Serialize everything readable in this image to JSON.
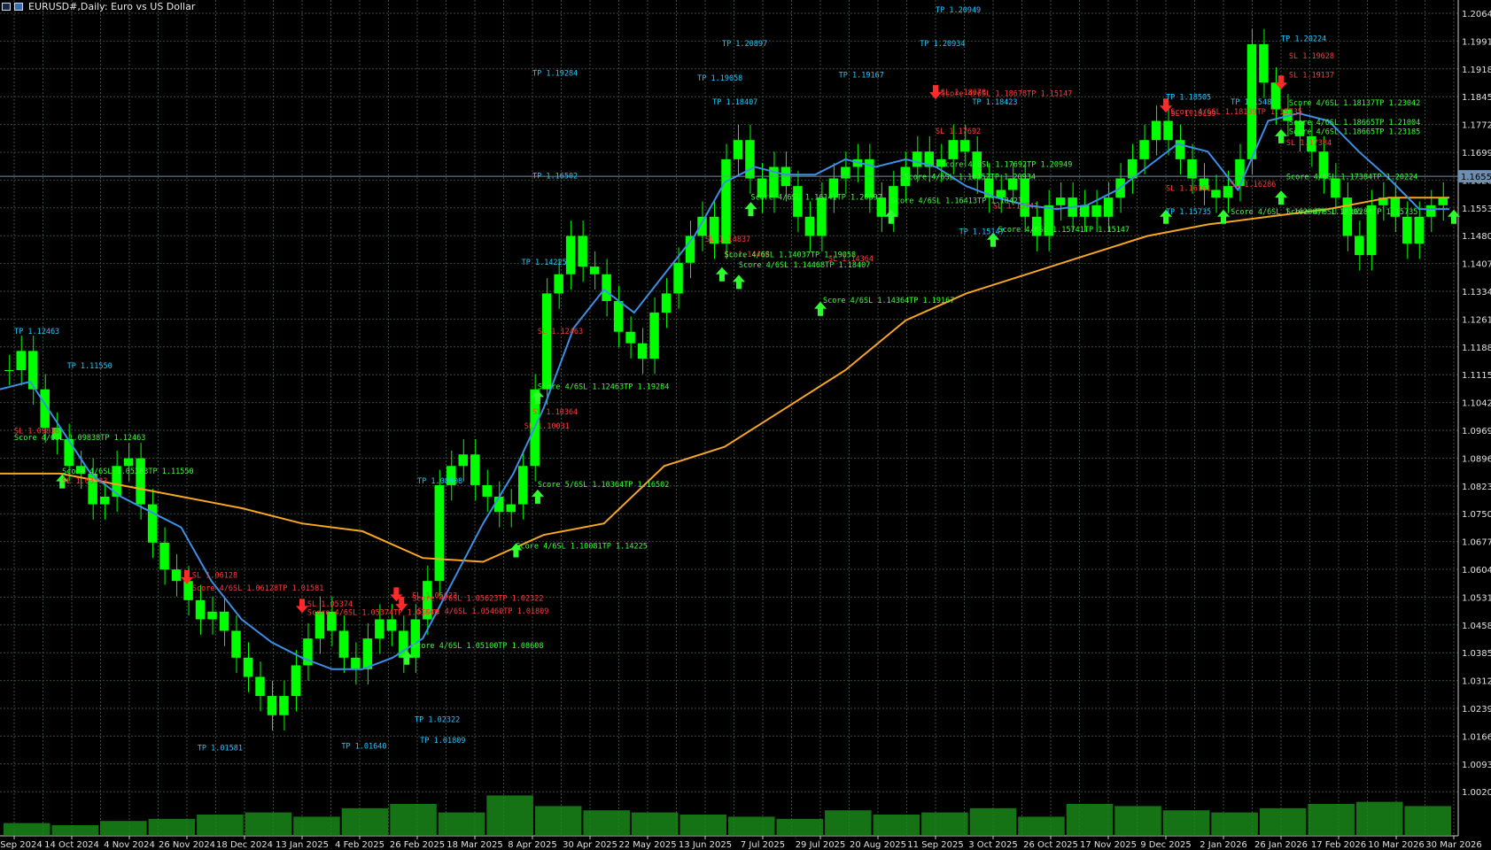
{
  "window": {
    "title": "EURUSD#,Daily: Euro vs US Dollar"
  },
  "colors": {
    "background": "#000000",
    "grid": "#3a4a3a",
    "bull_candle": "#00ff00",
    "ma_fast": "#3b8fe6",
    "ma_slow": "#f5a623",
    "buy_signal": "#2dff2d",
    "sell_signal": "#ff2b2b",
    "tp_label": "#20c8ff",
    "sl_label": "#ff3b3b",
    "buy_text": "#39ff39",
    "price_line": "#6f8fb0"
  },
  "price_axis": {
    "labels": [
      "1.20648",
      "1.19910",
      "1.19180",
      "1.18450",
      "1.17720",
      "1.16990",
      "1.16260",
      "1.15530",
      "1.14800",
      "1.14070",
      "1.13340",
      "1.12610",
      "1.11880",
      "1.11150",
      "1.10420",
      "1.09690",
      "1.08960",
      "1.08230",
      "1.07500",
      "1.06770",
      "1.06040",
      "1.05310",
      "1.04580",
      "1.03850",
      "1.03120",
      "1.02390",
      "1.01660",
      "1.00930",
      "1.00200"
    ],
    "current_price": "1.16555"
  },
  "time_axis": {
    "labels": [
      "20 Sep 2024",
      "14 Oct 2024",
      "4 Nov 2024",
      "26 Nov 2024",
      "18 Dec 2024",
      "13 Jan 2025",
      "4 Feb 2025",
      "26 Feb 2025",
      "18 Mar 2025",
      "8 Apr 2025",
      "30 Apr 2025",
      "22 May 2025",
      "13 Jun 2025",
      "7 Jul 2025",
      "29 Jul 2025",
      "20 Aug 2025",
      "11 Sep 2025",
      "3 Oct 2025",
      "26 Oct 2025",
      "17 Nov 2025",
      "9 Dec 2025",
      "2 Jan 2026",
      "26 Jan 2026",
      "17 Feb 2026",
      "10 Mar 2026",
      "30 Mar 2026"
    ]
  },
  "chart_data": {
    "type": "candlestick",
    "symbol": "EURUSD#",
    "timeframe": "Daily",
    "ylim": [
      1.0,
      1.2083
    ],
    "grid": true,
    "ma_fast": [
      1.11,
      1.112,
      1.1,
      1.088,
      1.082,
      1.078,
      1.074,
      1.06,
      1.05,
      1.044,
      1.04,
      1.037,
      1.037,
      1.04,
      1.045,
      1.06,
      1.075,
      1.088,
      1.105,
      1.126,
      1.136,
      1.13,
      1.14,
      1.15,
      1.164,
      1.168,
      1.166,
      1.166,
      1.17,
      1.168,
      1.17,
      1.168,
      1.163,
      1.16,
      1.158,
      1.157,
      1.158,
      1.162,
      1.168,
      1.174,
      1.172,
      1.162,
      1.18,
      1.182,
      1.18,
      1.172,
      1.165,
      1.157,
      1.157
    ],
    "ma_slow": [
      1.088,
      1.088,
      1.085,
      1.082,
      1.079,
      1.075,
      1.073,
      1.066,
      1.065,
      1.072,
      1.075,
      1.09,
      1.095,
      1.105,
      1.115,
      1.128,
      1.135,
      1.14,
      1.145,
      1.15,
      1.153,
      1.155,
      1.157,
      1.16,
      1.16
    ],
    "candles": [
      1.115,
      1.12,
      1.11,
      1.1,
      1.097,
      1.09,
      1.088,
      1.08,
      1.082,
      1.09,
      1.092,
      1.08,
      1.07,
      1.063,
      1.06,
      1.055,
      1.05,
      1.052,
      1.047,
      1.04,
      1.035,
      1.03,
      1.025,
      1.03,
      1.038,
      1.045,
      1.052,
      1.047,
      1.04,
      1.037,
      1.045,
      1.05,
      1.047,
      1.04,
      1.05,
      1.06,
      1.085,
      1.09,
      1.093,
      1.085,
      1.082,
      1.078,
      1.08,
      1.09,
      1.11,
      1.135,
      1.14,
      1.15,
      1.142,
      1.14,
      1.133,
      1.125,
      1.122,
      1.118,
      1.13,
      1.135,
      1.143,
      1.15,
      1.155,
      1.148,
      1.17,
      1.175,
      1.165,
      1.16,
      1.168,
      1.163,
      1.155,
      1.15,
      1.16,
      1.165,
      1.168,
      1.17,
      1.16,
      1.155,
      1.163,
      1.168,
      1.172,
      1.168,
      1.17,
      1.175,
      1.172,
      1.165,
      1.16,
      1.162,
      1.165,
      1.155,
      1.15,
      1.158,
      1.16,
      1.155,
      1.158,
      1.155,
      1.16,
      1.165,
      1.17,
      1.175,
      1.18,
      1.175,
      1.17,
      1.165,
      1.162,
      1.16,
      1.163,
      1.17,
      1.2,
      1.19,
      1.183,
      1.18,
      1.176,
      1.172,
      1.165,
      1.16,
      1.15,
      1.145,
      1.158,
      1.16,
      1.155,
      1.148,
      1.155,
      1.158,
      1.16
    ],
    "volume": [
      0.12,
      0.1,
      0.14,
      0.16,
      0.2,
      0.22,
      0.18,
      0.26,
      0.3,
      0.22,
      0.38,
      0.28,
      0.24,
      0.22,
      0.2,
      0.18,
      0.16,
      0.24,
      0.2,
      0.22,
      0.26,
      0.18,
      0.3,
      0.28,
      0.24,
      0.22,
      0.26,
      0.3,
      0.32,
      0.28
    ],
    "sell_markers": [
      {
        "date": "26 Nov 2024",
        "price": 1.061
      },
      {
        "date": "13 Jan 2025",
        "price": 1.0535
      },
      {
        "date": "18 Feb 2025",
        "price": 1.0565
      },
      {
        "date": "20 Feb 2025",
        "price": 1.054
      },
      {
        "date": "11 Sep 2025",
        "price": 1.1875
      },
      {
        "date": "9 Dec 2025",
        "price": 1.184
      },
      {
        "date": "26 Jan 2026",
        "price": 1.19
      }
    ],
    "buy_markers": [
      {
        "date": "10 Oct 2024",
        "price": 1.086
      },
      {
        "date": "22 Feb 2025",
        "price": 1.04
      },
      {
        "date": "2 Apr 2025",
        "price": 1.068
      },
      {
        "date": "10 Apr 2025",
        "price": 1.082
      },
      {
        "date": "10 Apr 2025",
        "price": 1.108
      },
      {
        "date": "20 Jun 2025",
        "price": 1.14
      },
      {
        "date": "27 Jun 2025",
        "price": 1.138
      },
      {
        "date": "2 Jul 2025",
        "price": 1.157
      },
      {
        "date": "29 Jul 2025",
        "price": 1.131
      },
      {
        "date": "25 Aug 2025",
        "price": 1.155
      },
      {
        "date": "3 Oct 2025",
        "price": 1.149
      },
      {
        "date": "9 Dec 2025",
        "price": 1.155
      },
      {
        "date": "2 Jan 2026",
        "price": 1.155
      },
      {
        "date": "26 Jan 2026",
        "price": 1.16
      },
      {
        "date": "26 Jan 2026",
        "price": 1.176
      },
      {
        "date": "30 Mar 2026",
        "price": 1.155
      }
    ]
  },
  "annotations": {
    "tp": [
      {
        "text": "TP 1.20949",
        "date": "11 Sep 2025",
        "price": 1.2083
      },
      {
        "text": "TP 1.20897",
        "date": "20 Jun 2025",
        "price": 1.1995
      },
      {
        "text": "TP 1.20934",
        "date": "5 Sep 2025",
        "price": 1.1995
      },
      {
        "text": "TP 1.19284",
        "date": "8 Apr 2025",
        "price": 1.1918
      },
      {
        "text": "TP 1.19058",
        "date": "10 Jun 2025",
        "price": 1.1905
      },
      {
        "text": "TP 1.19167",
        "date": "5 Aug 2025",
        "price": 1.1913
      },
      {
        "text": "TP 1.18407",
        "date": "16 Jun 2025",
        "price": 1.1843
      },
      {
        "text": "TP 1.18423",
        "date": "25 Sep 2025",
        "price": 1.1843
      },
      {
        "text": "TP 1.18505",
        "date": "9 Dec 2025",
        "price": 1.1855
      },
      {
        "text": "TP 1.1548",
        "date": "5 Jan 2026",
        "price": 1.1843
      },
      {
        "text": "TP 1.20224",
        "date": "26 Jan 2026",
        "price": 1.2008
      },
      {
        "text": "TP 1.16502",
        "date": "8 Apr 2025",
        "price": 1.165
      },
      {
        "text": "TP 1.15147",
        "date": "20 Sep 2025",
        "price": 1.1505
      },
      {
        "text": "TP 1.14225",
        "date": "4 Apr 2025",
        "price": 1.1425
      },
      {
        "text": "TP 1.12463",
        "date": "20 Sep 2024",
        "price": 1.1245
      },
      {
        "text": "TP 1.11550",
        "date": "12 Oct 2024",
        "price": 1.1155
      },
      {
        "text": "TP 1.08608",
        "date": "26 Feb 2025",
        "price": 1.0855
      },
      {
        "text": "TP 1.02322",
        "date": "25 Feb 2025",
        "price": 1.0232
      },
      {
        "text": "TP 1.01809",
        "date": "27 Feb 2025",
        "price": 1.0178
      },
      {
        "text": "TP 1.01640",
        "date": "28 Jan 2025",
        "price": 1.0163
      },
      {
        "text": "TP 1.01581",
        "date": "30 Nov 2024",
        "price": 1.0158
      },
      {
        "text": "TP 1.15735",
        "date": "9 Dec 2025",
        "price": 1.1557
      }
    ],
    "sl": [
      {
        "text": "SL 1.06128",
        "date": "28 Nov 2024",
        "price": 1.0608
      },
      {
        "text": "SL 1.05374",
        "date": "15 Jan 2025",
        "price": 1.0533
      },
      {
        "text": "SL 1.05623",
        "date": "24 Feb 2025",
        "price": 1.0555
      },
      {
        "text": "SL 1.03533",
        "date": "10 Oct 2024",
        "price": 1.0855
      },
      {
        "text": "SL 1.09836",
        "date": "20 Sep 2024",
        "price": 1.0985
      },
      {
        "text": "SL 1.12463",
        "date": "10 Apr 2025",
        "price": 1.1245
      },
      {
        "text": "SL 1.10364",
        "date": "8 Apr 2025",
        "price": 1.1035
      },
      {
        "text": "SL 1.10031",
        "date": "5 Apr 2025",
        "price": 1.0998
      },
      {
        "text": "SL 1.14837",
        "date": "13 Jun 2025",
        "price": 1.1485
      },
      {
        "text": "SL 1.14468",
        "date": "21 Jun 2025",
        "price": 1.1446
      },
      {
        "text": "SL 1.14364",
        "date": "1 Aug 2025",
        "price": 1.1434
      },
      {
        "text": "SL 1.17692",
        "date": "11 Sep 2025",
        "price": 1.1767
      },
      {
        "text": "SL 1.16161",
        "date": "9 Dec 2025",
        "price": 1.1618
      },
      {
        "text": "SL 1.15741",
        "date": "3 Oct 2025",
        "price": 1.1572
      },
      {
        "text": "SL 1.17384",
        "date": "28 Jan 2026",
        "price": 1.1737
      },
      {
        "text": "SL 1.16286",
        "date": "5 Jan 2026",
        "price": 1.1628
      },
      {
        "text": "SL 1.19628",
        "date": "29 Jan 2026",
        "price": 1.1963
      },
      {
        "text": "SL 1.19137",
        "date": "29 Jan 2026",
        "price": 1.1913
      },
      {
        "text": "SL 1.18139",
        "date": "11 Dec 2025",
        "price": 1.1813
      },
      {
        "text": "SL 1.18678",
        "date": "13 Sep 2025",
        "price": 1.1868
      }
    ],
    "score_buy": [
      {
        "text": "Score 4/6SL 1.09838TP 1.12463",
        "date": "20 Sep 2024",
        "price": 1.0968
      },
      {
        "text": "Score 4/6SL 1.05383TP 1.11550",
        "date": "10 Oct 2024",
        "price": 1.088
      },
      {
        "text": "Score 4/6SL 1.05100TP 1.08608",
        "date": "24 Feb 2025",
        "price": 1.0425
      },
      {
        "text": "Score 4/6SL 1.10081TP 1.14225",
        "date": "2 Apr 2025",
        "price": 1.0685
      },
      {
        "text": "Score 5/6SL 1.10364TP 1.16502",
        "date": "10 Apr 2025",
        "price": 1.0845
      },
      {
        "text": "Score 4/6SL 1.12463TP 1.19284",
        "date": "10 Apr 2025",
        "price": 1.11
      },
      {
        "text": "Score 4/6SL 1.14037TP 1.19058",
        "date": "21 Jun 2025",
        "price": 1.1445
      },
      {
        "text": "Score 4/6SL 1.14468TP 1.18407",
        "date": "27 Jun 2025",
        "price": 1.1418
      },
      {
        "text": "Score 4/6SL 1.14364TP 1.19167",
        "date": "30 Jul 2025",
        "price": 1.1325
      },
      {
        "text": "Score 4/6SL 1.16141TP 1.20897",
        "date": "2 Jul 2025",
        "price": 1.1595
      },
      {
        "text": "Score 4/6SL 1.17692TP 1.20949",
        "date": "13 Sep 2025",
        "price": 1.168
      },
      {
        "text": "Score 4/6SL 1.16152TP 1.20934",
        "date": "30 Aug 2025",
        "price": 1.1648
      },
      {
        "text": "Score 4/6SL 1.16413TP 1.18423",
        "date": "25 Aug 2025",
        "price": 1.1585
      },
      {
        "text": "Score 4/6SL 1.15741TP 1.15147",
        "date": "5 Oct 2025",
        "price": 1.151
      },
      {
        "text": "Score 4/6SL 1.16286TP 1.18505",
        "date": "5 Jan 2026",
        "price": 1.1557
      },
      {
        "text": "Score 4/6SL 1.16286TP 1.15735",
        "date": "28 Jan 2026",
        "price": 1.1557
      },
      {
        "text": "Score 4/6SL 1.17384TP 1.20224",
        "date": "28 Jan 2026",
        "price": 1.1648
      },
      {
        "text": "Score 4/6SL 1.18137TP 1.23042",
        "date": "29 Jan 2026",
        "price": 1.184
      },
      {
        "text": "Score 4/6SL 1.18665TP 1.21004",
        "date": "29 Jan 2026",
        "price": 1.179
      },
      {
        "text": "Score 4/6SL 1.18665TP 1.23185",
        "date": "29 Jan 2026",
        "price": 1.1765
      }
    ],
    "score_sell": [
      {
        "text": "Score 4/6SL 1.06128TP 1.01581",
        "date": "28 Nov 2024",
        "price": 1.0575
      },
      {
        "text": "Score 4/6SL 1.05374TP 1.01640",
        "date": "15 Jan 2025",
        "price": 1.0512
      },
      {
        "text": "Score 4/6SL 1.05623TP 1.02322",
        "date": "24 Feb 2025",
        "price": 1.0548
      },
      {
        "text": "Score 4/6SL 1.05460TP 1.01809",
        "date": "26 Feb 2025",
        "price": 1.0515
      },
      {
        "text": "Score 4/6SL 1.18678TP 1.15147",
        "date": "13 Sep 2025",
        "price": 1.1865
      },
      {
        "text": "Score 4/6SL 1.18139TP 1.15735",
        "date": "11 Dec 2025",
        "price": 1.1818
      }
    ]
  }
}
